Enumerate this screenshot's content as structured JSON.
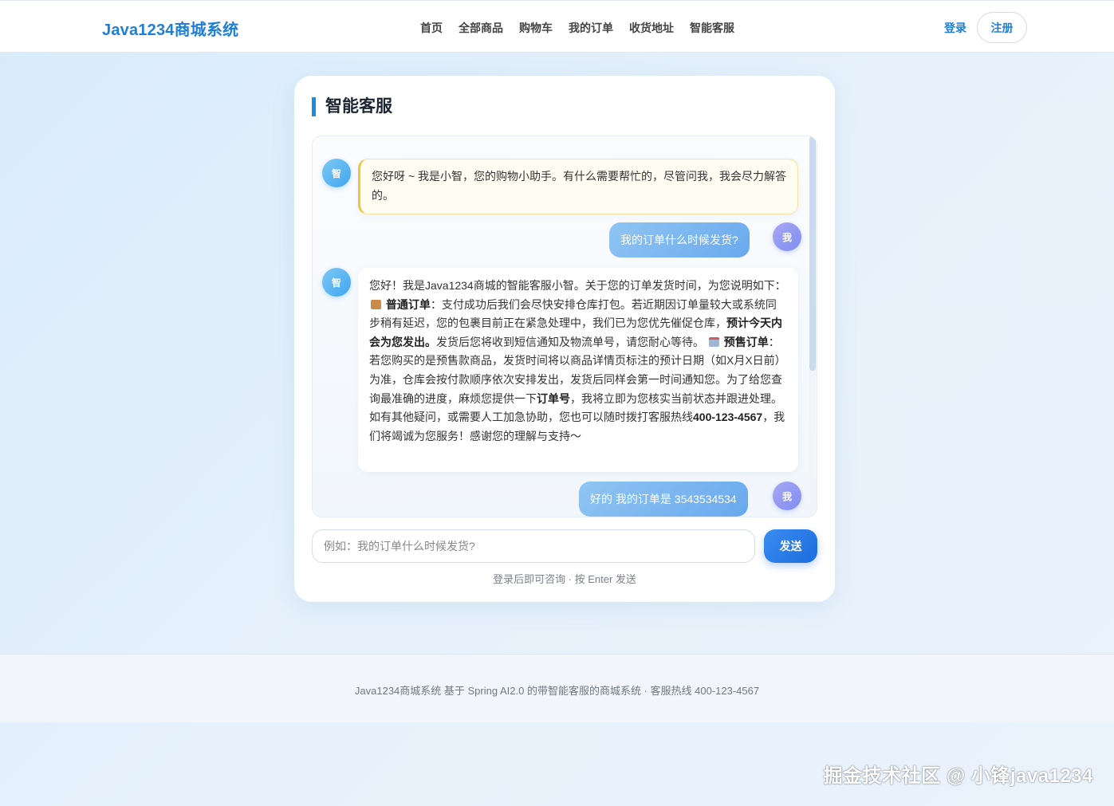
{
  "header": {
    "logo": "Java1234商城系统",
    "nav": [
      "首页",
      "全部商品",
      "购物车",
      "我的订单",
      "收货地址",
      "智能客服"
    ],
    "login_label": "登录",
    "register_label": "注册"
  },
  "chat": {
    "title": "智能客服",
    "bot_avatar": "智",
    "me_avatar": "我",
    "greeting": "您好呀 ~ 我是小智，您的购物小助手。有什么需要帮忙的，尽管问我，我会尽力解答的。",
    "user_msg_1": "我的订单什么时候发货?",
    "reply": {
      "p1": "您好！我是Java1234商城的智能客服小智。关于您的订单发货时间，为您说明如下：",
      "t1": "普通订单",
      "p2": "：支付成功后我们会尽快安排仓库打包。若近期因订单量较大或系统同步稍有延迟，您的包裹目前正在紧急处理中，我们已为您优先催促仓库，",
      "b1": "预计今天内会为您发出。",
      "p3": "发货后您将收到短信通知及物流单号，请您耐心等待。",
      "t2": "预售订单",
      "p4": "：若您购买的是预售款商品，发货时间将以商品详情页标注的预计日期（如X月X日前）为准，仓库会按付款顺序依次安排发出，发货后同样会第一时间通知您。为了给您查询最准确的进度，麻烦您提供一下",
      "b2": "订单号",
      "p5": "，我将立即为您核实当前状态并跟进处理。如有其他疑问，或需要人工加急协助，您也可以随时拨打客服热线",
      "b3": "400-123-4567",
      "p6": "，我们将竭诚为您服务！感谢您的理解与支持～"
    },
    "user_msg_2": "好的 我的订单是 3543534534",
    "input_placeholder": "例如：我的订单什么时候发货?",
    "send_label": "发送",
    "hint": "登录后即可咨询 · 按 Enter 发送"
  },
  "footer": {
    "text": "Java1234商城系统 基于 Spring AI2.0 的带智能客服的商城系统 · 客服热线 400-123-4567"
  },
  "watermark": "掘金技术社区 @ 小锋java1234",
  "icons": {
    "package": "package-emoji-icon",
    "calendar": "calendar-emoji-icon"
  },
  "colors": {
    "brand": "#1f7fd6",
    "accent": "#1f8ae0",
    "send": "#1c6be0"
  }
}
